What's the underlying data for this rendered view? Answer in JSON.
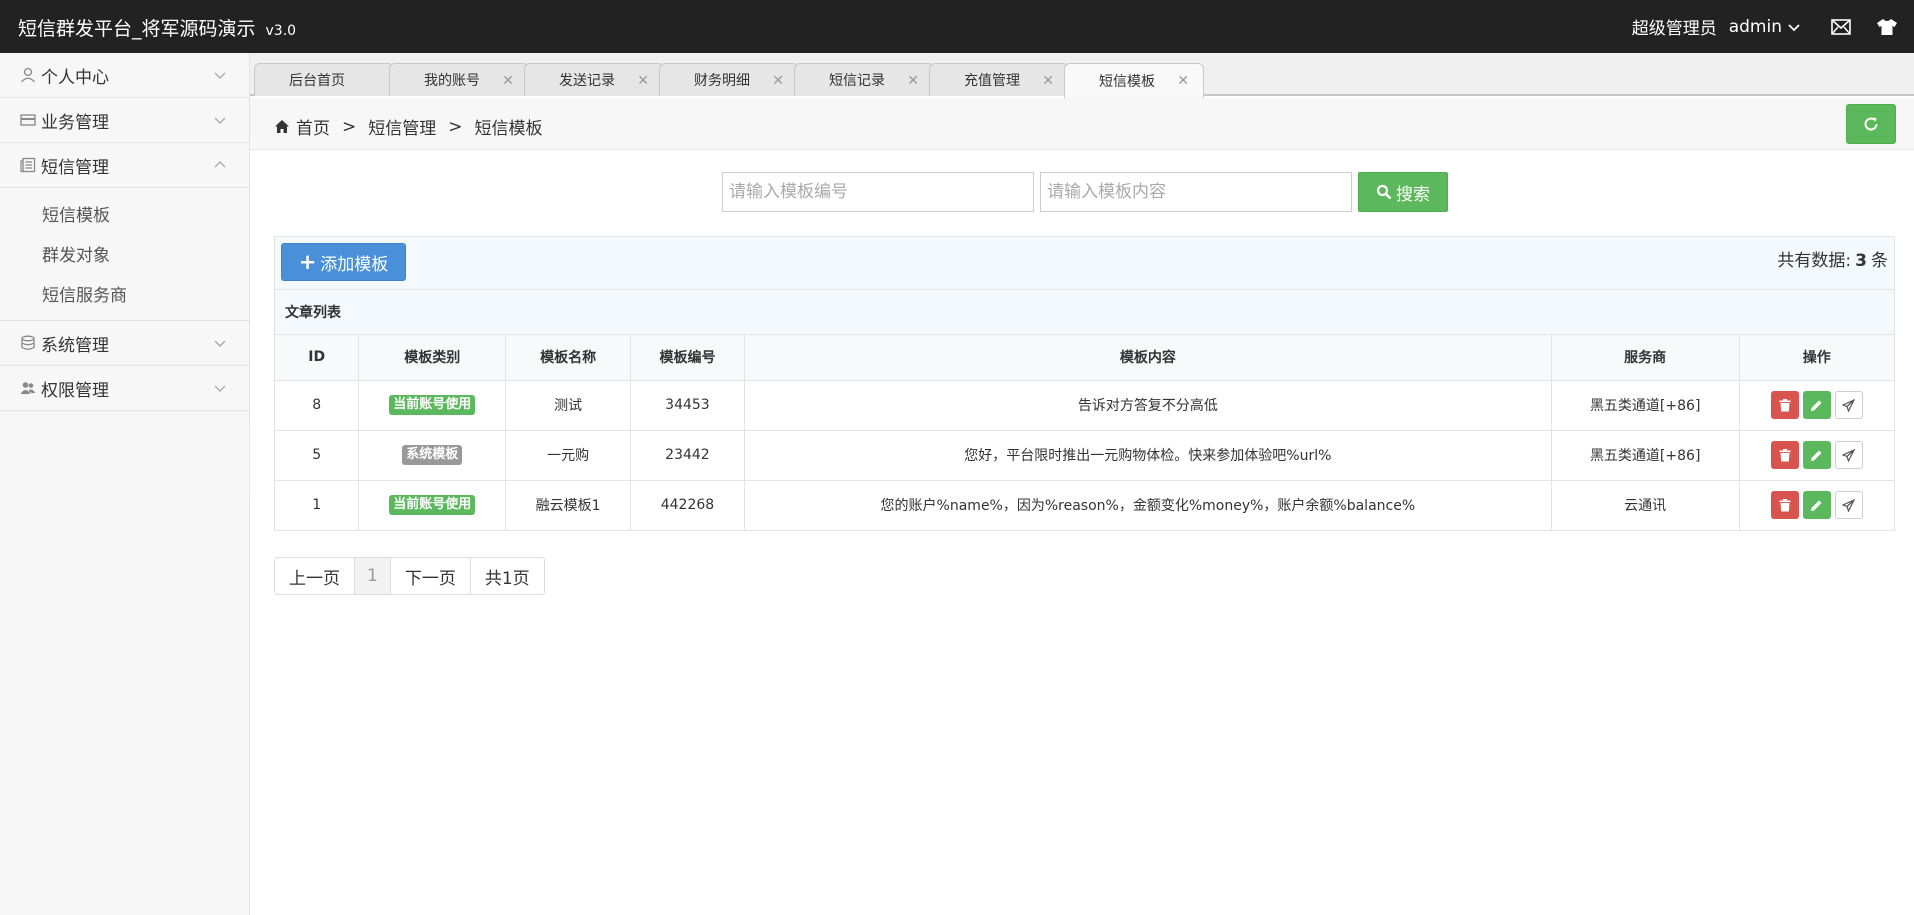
{
  "header": {
    "title": "短信群发平台_将军源码演示",
    "version": "v3.0",
    "role": "超级管理员",
    "username": "admin"
  },
  "sidebar": {
    "items": [
      {
        "label": "个人中心",
        "icon": "user-icon"
      },
      {
        "label": "业务管理",
        "icon": "card-icon"
      },
      {
        "label": "短信管理",
        "icon": "news-icon",
        "expanded": true,
        "children": [
          "短信模板",
          "群发对象",
          "短信服务商"
        ]
      },
      {
        "label": "系统管理",
        "icon": "database-icon"
      },
      {
        "label": "权限管理",
        "icon": "users-icon"
      }
    ]
  },
  "tabs": [
    {
      "label": "后台首页",
      "closable": false
    },
    {
      "label": "我的账号",
      "closable": true
    },
    {
      "label": "发送记录",
      "closable": true
    },
    {
      "label": "财务明细",
      "closable": true
    },
    {
      "label": "短信记录",
      "closable": true
    },
    {
      "label": "充值管理",
      "closable": true
    },
    {
      "label": "短信模板",
      "closable": true,
      "active": true
    }
  ],
  "breadcrumb": [
    "首页",
    "短信管理",
    "短信模板"
  ],
  "breadcrumb_sep": ">",
  "search": {
    "code_placeholder": "请输入模板编号",
    "content_placeholder": "请输入模板内容",
    "button_label": "搜索"
  },
  "toolbar": {
    "add_label": "添加模板",
    "total_prefix": "共有数据:",
    "total_count": "3",
    "total_suffix": "条"
  },
  "table": {
    "title": "文章列表",
    "columns": [
      "ID",
      "模板类别",
      "模板名称",
      "模板编号",
      "模板内容",
      "服务商",
      "操作"
    ],
    "rows": [
      {
        "id": "8",
        "category": "当前账号使用",
        "category_color": "#5cb85c",
        "name": "测试",
        "code": "34453",
        "content": "告诉对方答复不分高低",
        "provider": "黑五类通道[+86]"
      },
      {
        "id": "5",
        "category": "系统模板",
        "category_color": "#999999",
        "name": "一元购",
        "code": "23442",
        "content": "您好，平台限时推出一元购物体检。快来参加体验吧%url%",
        "provider": "黑五类通道[+86]"
      },
      {
        "id": "1",
        "category": "当前账号使用",
        "category_color": "#5cb85c",
        "name": "融云模板1",
        "code": "442268",
        "content": "您的账户%name%，因为%reason%，金额变化%money%，账户余额%balance%",
        "provider": "云通讯"
      }
    ]
  },
  "pager": {
    "prev": "上一页",
    "current": "1",
    "next": "下一页",
    "total": "共1页"
  },
  "colors": {
    "topbar": "#222222",
    "success": "#5cb85c",
    "primary": "#4a90d9",
    "danger": "#d9534f"
  }
}
